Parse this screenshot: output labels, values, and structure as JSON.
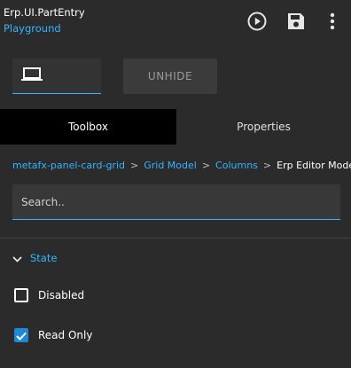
{
  "header": {
    "title": "Erp.UI.PartEntry",
    "subtitle": "Playground",
    "icons": [
      "play-circle-icon",
      "save-icon",
      "more-vert-icon"
    ]
  },
  "toolbar": {
    "device_icon": "laptop-icon",
    "unhide_label": "UNHIDE"
  },
  "tabs": [
    {
      "label": "Toolbox",
      "active": true
    },
    {
      "label": "Properties",
      "active": false
    }
  ],
  "breadcrumb": {
    "items": [
      "metafx-panel-card-grid",
      "Grid Model",
      "Columns"
    ],
    "current": "Erp Editor Model",
    "separator": ">"
  },
  "search": {
    "placeholder": "Search..",
    "value": ""
  },
  "section": {
    "label": "State",
    "expanded": true
  },
  "checkboxes": [
    {
      "label": "Disabled",
      "checked": false
    },
    {
      "label": "Read Only",
      "checked": true
    }
  ],
  "colors": {
    "accent": "#33b5ff",
    "background": "#2b2b2b",
    "active_tab": "#000000",
    "checkbox_checked": "#1e88d6"
  }
}
